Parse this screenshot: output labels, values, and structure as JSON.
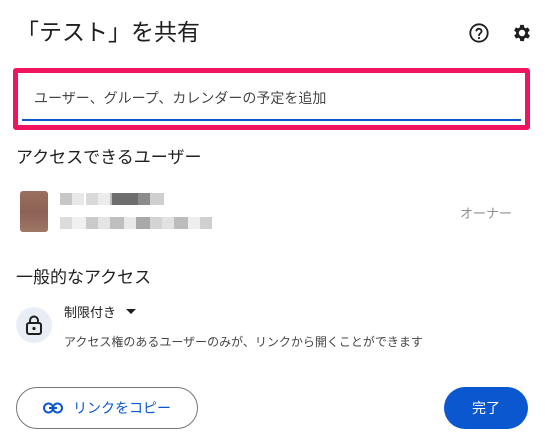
{
  "dialog": {
    "title": "「テスト」を共有",
    "help_icon": "help-circle-icon",
    "settings_icon": "gear-icon"
  },
  "add_people": {
    "placeholder": "ユーザー、グループ、カレンダーの予定を追加"
  },
  "people_section": {
    "title": "アクセスできるユーザー",
    "users": [
      {
        "role": "オーナー"
      }
    ]
  },
  "general_access": {
    "title": "一般的なアクセス",
    "lock_icon": "lock-icon",
    "selected": "制限付き",
    "description": "アクセス権のあるユーザーのみが、リンクから開くことができます"
  },
  "footer": {
    "copy_link_label": "リンクをコピー",
    "copy_link_icon": "link-icon",
    "done_label": "完了"
  },
  "colors": {
    "accent": "#0b57d0",
    "highlight_border": "#f0135f",
    "lock_bg": "#e9eef6"
  }
}
